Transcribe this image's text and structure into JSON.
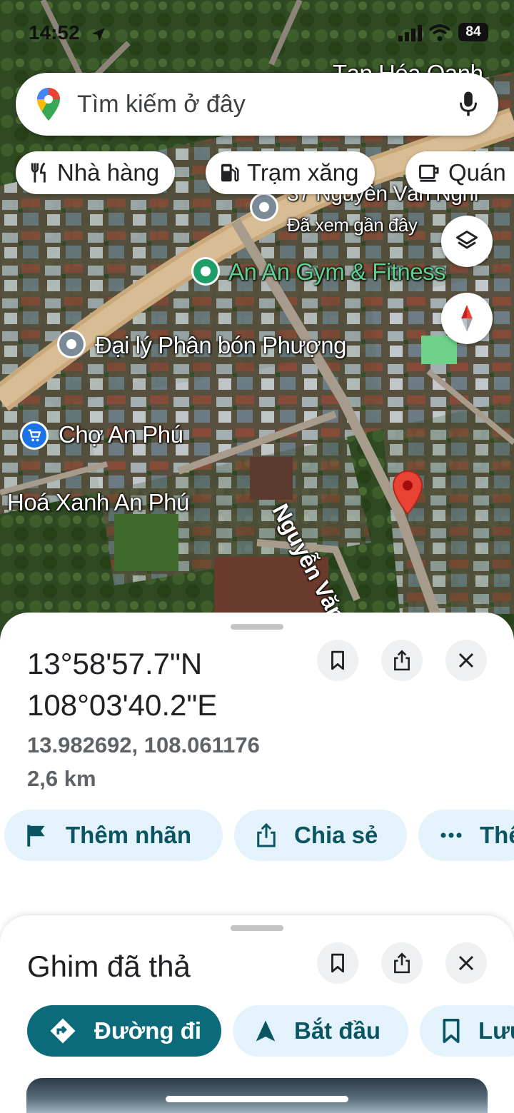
{
  "status_bar": {
    "time": "14:52",
    "battery": "84"
  },
  "search": {
    "placeholder": "Tìm kiếm ở đây"
  },
  "chips": [
    {
      "label": "Nhà hàng",
      "icon": "restaurant-icon"
    },
    {
      "label": "Trạm xăng",
      "icon": "gas-station-icon"
    },
    {
      "label": "Quán",
      "icon": "cafe-icon"
    }
  ],
  "map": {
    "top_partial_label": "Tạp Hóa Oanh",
    "places": [
      {
        "name": "37 Nguyễn Văn Nghi",
        "sub": "Đã xem gần đây"
      },
      {
        "name": "An An Gym & Fitness"
      },
      {
        "name": "Đại lý Phân bón Phượng"
      },
      {
        "name": "Chợ An Phú"
      },
      {
        "name": "Hoá Xanh An Phú"
      }
    ],
    "street_label": "Nguyễn Văn Nghi"
  },
  "details": {
    "coords_dms_lat": "13°58'57.7\"N",
    "coords_dms_lng": "108°03'40.2\"E",
    "coords_decimal": "13.982692, 108.061176",
    "distance": "2,6 km",
    "actions": [
      {
        "label": "Thêm nhãn",
        "icon": "flag-icon"
      },
      {
        "label": "Chia sẻ",
        "icon": "share-icon"
      },
      {
        "label": "Thêm",
        "icon": "more-icon"
      }
    ]
  },
  "dropped_pin": {
    "title": "Ghim đã thả",
    "actions": [
      {
        "label": "Đường đi",
        "icon": "directions-icon"
      },
      {
        "label": "Bắt đầu",
        "icon": "navigation-arrow-icon"
      },
      {
        "label": "Lưu",
        "icon": "bookmark-icon"
      }
    ]
  },
  "colors": {
    "primary": "#0b6b7a",
    "pill_bg": "#e4f3fb",
    "pin_red": "#ea4335"
  }
}
